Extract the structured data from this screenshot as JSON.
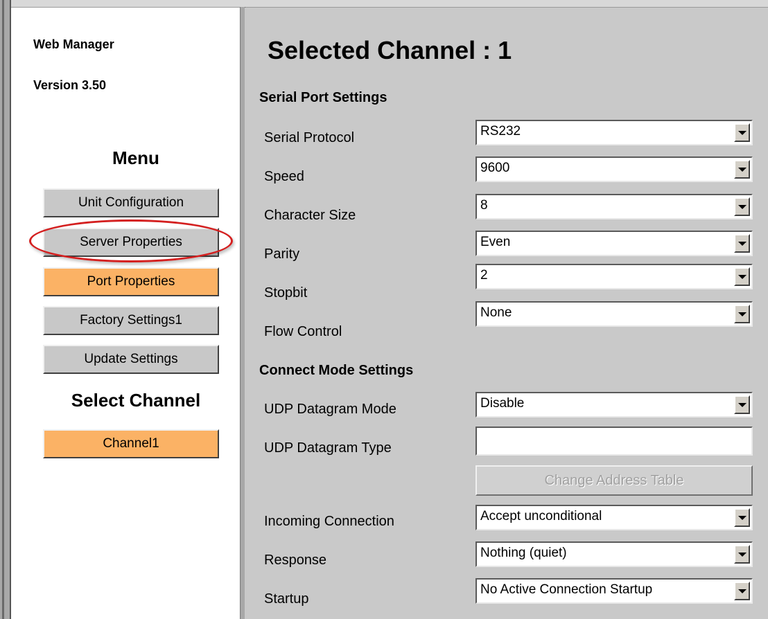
{
  "sidebar": {
    "app_name": "Web Manager",
    "version": "Version 3.50",
    "menu_heading": "Menu",
    "menu_items": [
      {
        "label": "Unit Configuration",
        "active": false
      },
      {
        "label": "Server Properties",
        "active": false,
        "highlighted": true
      },
      {
        "label": "Port Properties",
        "active": true
      },
      {
        "label": "Factory Settings1",
        "active": false
      },
      {
        "label": "Update Settings",
        "active": false
      }
    ],
    "channel_heading": "Select Channel",
    "channels": [
      {
        "label": "Channel1",
        "active": true
      }
    ]
  },
  "main": {
    "title": "Selected Channel : 1",
    "serial_section": {
      "heading": "Serial Port Settings",
      "fields": [
        {
          "label": "Serial Protocol",
          "value": "RS232"
        },
        {
          "label": "Speed",
          "value": "9600"
        },
        {
          "label": "Character Size",
          "value": "8"
        },
        {
          "label": "Parity",
          "value": "Even"
        },
        {
          "label": "Stopbit",
          "value": "2"
        },
        {
          "label": "Flow Control",
          "value": "None"
        }
      ]
    },
    "connect_section": {
      "heading": "Connect Mode Settings",
      "udp_mode": {
        "label": "UDP Datagram Mode",
        "value": "Disable"
      },
      "udp_type": {
        "label": "UDP Datagram Type",
        "value": ""
      },
      "change_address_button": "Change Address Table",
      "incoming": {
        "label": "Incoming Connection",
        "value": "Accept unconditional"
      },
      "response": {
        "label": "Response",
        "value": "Nothing (quiet)"
      },
      "startup": {
        "label": "Startup",
        "value": "No Active Connection Startup"
      }
    }
  },
  "colors": {
    "active_button": "#fbb265",
    "button": "#c8c8c8",
    "panel_background": "#c9c9c9",
    "highlight_ring": "#d41f1f"
  }
}
